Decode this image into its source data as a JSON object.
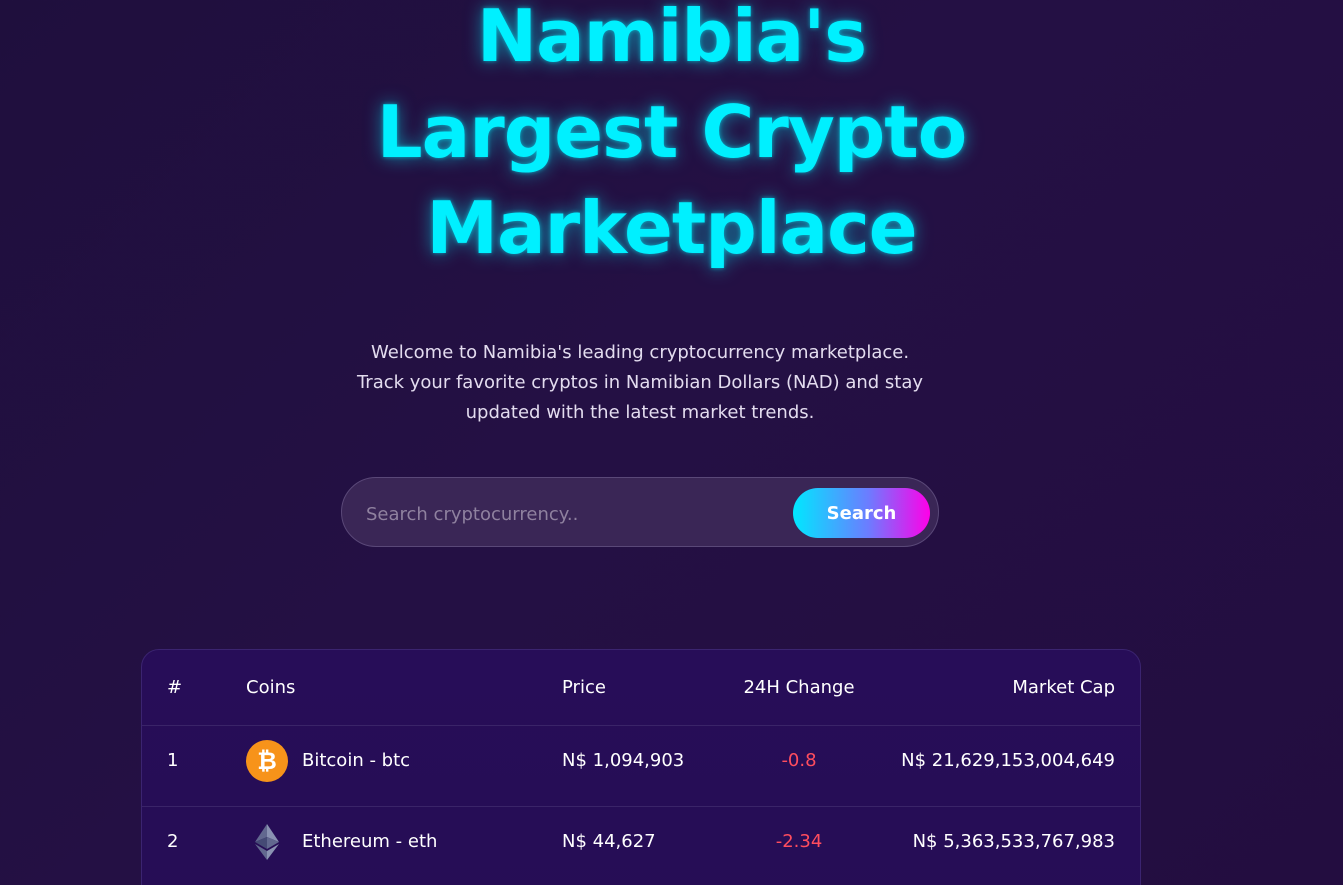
{
  "hero": {
    "title_lines": [
      "Namibia's",
      "Largest Crypto",
      "Marketplace"
    ],
    "subtitle_lines": [
      "Welcome to Namibia's leading cryptocurrency marketplace.",
      "Track your favorite cryptos in Namibian Dollars (NAD) and stay",
      "updated with the latest market trends."
    ]
  },
  "search": {
    "placeholder": "Search cryptocurrency..",
    "button_label": "Search"
  },
  "table": {
    "headers": {
      "rank": "#",
      "coins": "Coins",
      "price": "Price",
      "change": "24H Change",
      "market_cap": "Market Cap"
    },
    "rows": [
      {
        "rank": "1",
        "icon": "bitcoin-icon",
        "icon_glyph": "₿",
        "coin": "Bitcoin - btc",
        "price": "N$ 1,094,903",
        "change": "-0.8",
        "market_cap": "N$ 21,629,153,004,649"
      },
      {
        "rank": "2",
        "icon": "ethereum-icon",
        "coin": "Ethereum - eth",
        "price": "N$ 44,627",
        "change": "-2.34",
        "market_cap": "N$ 5,363,533,767,983"
      }
    ]
  },
  "colors": {
    "accent_cyan": "#00f0ff",
    "accent_magenta": "#ff00e8",
    "negative": "#ff4d5e",
    "background": "#1f0f3d",
    "bitcoin": "#f7931a"
  }
}
